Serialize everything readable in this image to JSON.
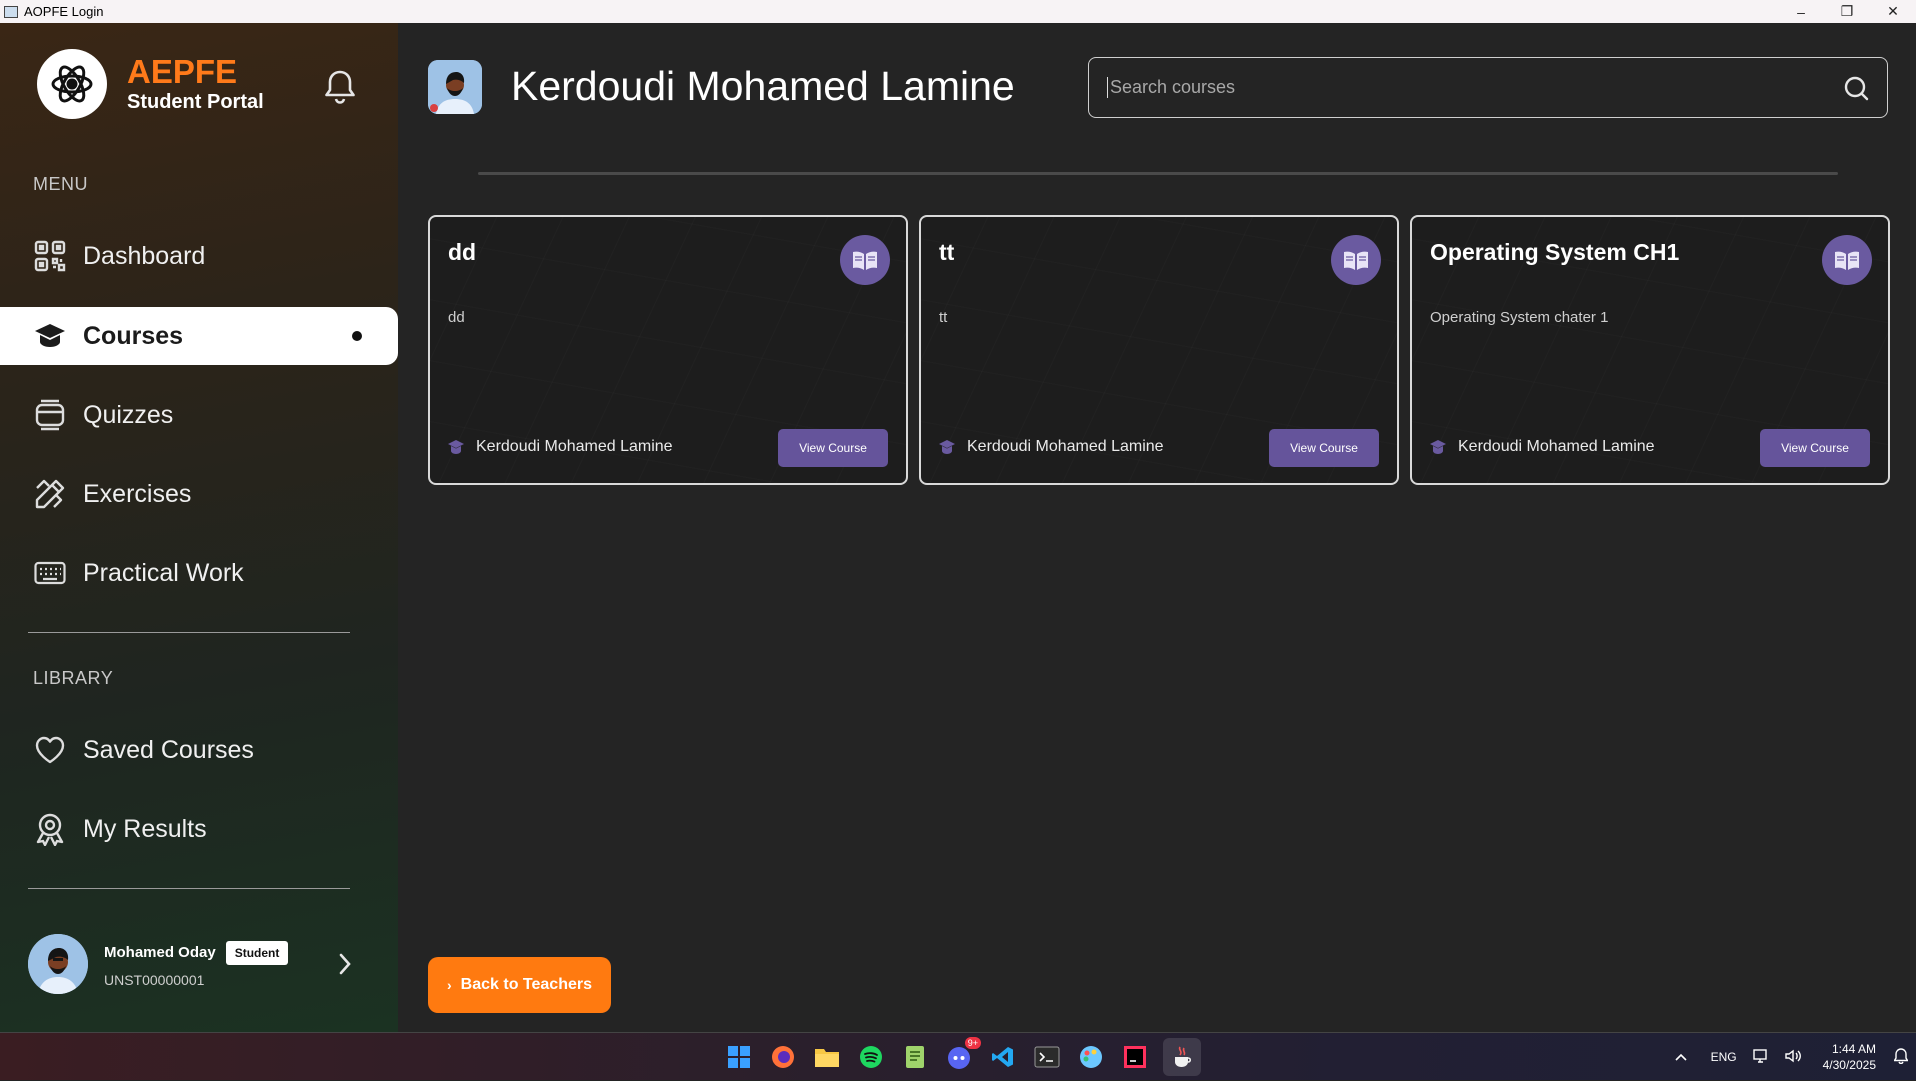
{
  "window": {
    "title": "AOPFE Login",
    "minimize": "–",
    "maximize": "❐",
    "close": "✕"
  },
  "sidebar": {
    "brand_name": "AEPFE",
    "brand_sub": "Student Portal",
    "menu_label": "MENU",
    "library_label": "LIBRARY",
    "menu": [
      {
        "label": "Dashboard",
        "icon": "qr-grid-icon"
      },
      {
        "label": "Courses",
        "icon": "graduation-cap-icon",
        "active": true
      },
      {
        "label": "Quizzes",
        "icon": "quiz-icon"
      },
      {
        "label": "Exercises",
        "icon": "pencil-ruler-icon"
      },
      {
        "label": "Practical Work",
        "icon": "keyboard-icon"
      }
    ],
    "library": [
      {
        "label": "Saved Courses",
        "icon": "heart-icon"
      },
      {
        "label": "My Results",
        "icon": "award-icon"
      }
    ],
    "user": {
      "name": "Mohamed Oday",
      "role": "Student",
      "id": "UNST00000001"
    }
  },
  "main": {
    "teacher_name": "Kerdoudi Mohamed Lamine",
    "search_placeholder": "Search courses",
    "courses": [
      {
        "title": "dd",
        "description": "dd",
        "author": "Kerdoudi Mohamed Lamine",
        "button": "View Course"
      },
      {
        "title": "tt",
        "description": "tt",
        "author": "Kerdoudi Mohamed Lamine",
        "button": "View Course"
      },
      {
        "title": "Operating System CH1",
        "description": "Operating System chater 1",
        "author": "Kerdoudi Mohamed Lamine",
        "button": "View Course"
      }
    ],
    "back_button": "Back to Teachers"
  },
  "taskbar": {
    "language": "ENG",
    "time": "1:44 AM",
    "date": "4/30/2025",
    "discord_badge": "9+"
  },
  "colors": {
    "accent": "#ff7a1a",
    "purple": "#65549b",
    "background": "#242424"
  }
}
